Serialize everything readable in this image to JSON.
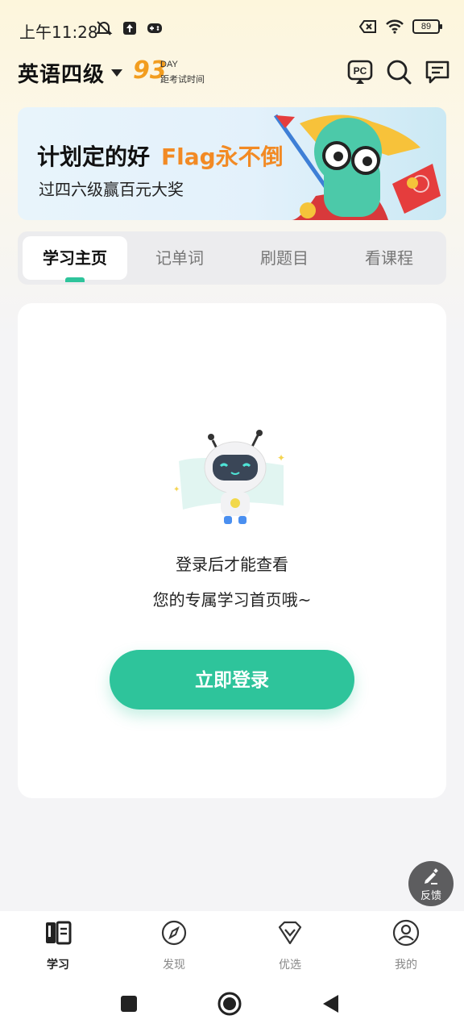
{
  "status_bar": {
    "time": "上午11:28",
    "battery": "89"
  },
  "header": {
    "exam_title": "英语四级",
    "countdown_days": "93",
    "countdown_unit": "DAY",
    "countdown_desc": "距考试时间"
  },
  "banner": {
    "line1_main": "计划定的好",
    "line1_highlight": "Flag永不倒",
    "line2": "过四六级赢百元大奖"
  },
  "tabs": [
    {
      "label": "学习主页",
      "active": true
    },
    {
      "label": "记单词",
      "active": false
    },
    {
      "label": "刷题目",
      "active": false
    },
    {
      "label": "看课程",
      "active": false
    }
  ],
  "main": {
    "message_line1": "登录后才能查看",
    "message_line2": "您的专属学习首页哦~",
    "login_button": "立即登录"
  },
  "feedback": {
    "label": "反馈"
  },
  "bottom_nav": [
    {
      "label": "学习",
      "icon": "book-icon",
      "active": true
    },
    {
      "label": "发现",
      "icon": "compass-icon",
      "active": false
    },
    {
      "label": "优选",
      "icon": "diamond-icon",
      "active": false
    },
    {
      "label": "我的",
      "icon": "profile-icon",
      "active": false
    }
  ],
  "colors": {
    "accent": "#2ec49b",
    "countdown": "#f29d1f",
    "banner_highlight": "#f28a24"
  }
}
